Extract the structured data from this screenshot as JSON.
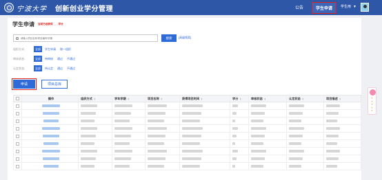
{
  "header": {
    "logo_text": "宁波大学",
    "app_title": "创新创业学分管理",
    "nav": {
      "public": "公告",
      "active": "学生申请",
      "user": "学生用"
    }
  },
  "page": {
    "title": "学生申请",
    "subtitle": "当前已经获得 ___ 学分"
  },
  "search": {
    "placeholder": "请输入项目名称/项目编号/学期",
    "button": "搜索",
    "advanced": "[高级搜索]"
  },
  "filters": [
    {
      "label": "组织方式:",
      "options": [
        "全部",
        "学生申请",
        "统一组织"
      ],
      "selected": 0
    },
    {
      "label": "审核状态:",
      "options": [
        "全部",
        "待审核",
        "通过",
        "不通过"
      ],
      "selected": 0
    },
    {
      "label": "认定状态:",
      "options": [
        "全部",
        "待认定",
        "通过",
        "不通过"
      ],
      "selected": 0
    }
  ],
  "actions": {
    "apply": "申请",
    "catalog": "项目总库"
  },
  "table": {
    "columns": [
      "操作",
      "组织方式",
      "学年学期",
      "项目名称",
      "获得项目时间",
      "学分",
      "审核状态",
      "认定状态",
      "项目描述"
    ],
    "rows": 9
  },
  "colors": {
    "header": "#2e57a8",
    "accent": "#2f6bd8",
    "highlight": "#e0201b"
  }
}
